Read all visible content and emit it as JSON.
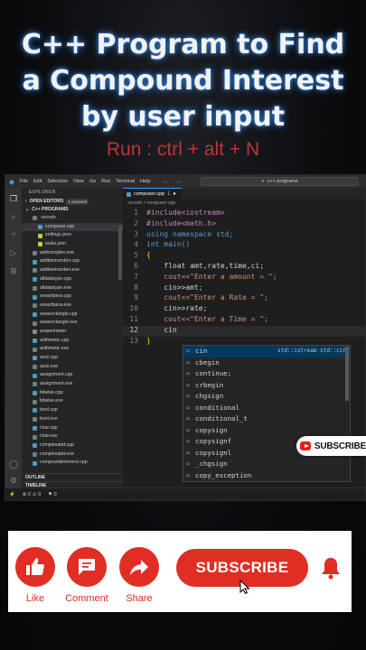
{
  "header": {
    "title_line1": "C++  Program to Find",
    "title_line2": "a Compound Interest",
    "title_line3": "by user input",
    "run_hint": "Run : ctrl + alt + N"
  },
  "vscode": {
    "menu": [
      "File",
      "Edit",
      "Selection",
      "View",
      "Go",
      "Run",
      "Terminal",
      "Help"
    ],
    "command_center": "c++ programs",
    "explorer_title": "EXPLORER",
    "open_editors": "OPEN EDITORS",
    "unsaved_badge": "1 unsaved",
    "folder": "C++ PROGRAMS",
    "files": [
      ".vscode",
      "compuser.cpp",
      "settings.json",
      "tasks.json",
      "addcomplex.exe",
      "addtwonumber.cpp",
      "addtwonumber.exe",
      "alldatatype.cpp",
      "alldatatype.exe",
      "areaofpera.cpp",
      "areaofpera.exe",
      "arearectangle.cpp",
      "arearectangle.exe",
      "areperimeter",
      "arithmetic.cpp",
      "arithmetic.exe",
      "ascii.cpp",
      "ascii.exe",
      "assignment.cpp",
      "assignment.exe",
      "bitwise.cpp",
      "bitwise.exe",
      "bool.cpp",
      "bool.exe",
      "char.cpp",
      "char.exe",
      "complexadd.cpp",
      "complexadd.exe",
      "compoundintererst.cpp"
    ],
    "outline": "OUTLINE",
    "timeline": "TIMELINE",
    "tab": {
      "name": "compuser.cpp",
      "index": "1"
    },
    "breadcrumb": ".vscode  >  compuser.cpp",
    "code_lines": [
      {
        "n": "1",
        "text": "#include<iostream>"
      },
      {
        "n": "2",
        "text": "#include<math.h>"
      },
      {
        "n": "3",
        "text": "using namespace std;"
      },
      {
        "n": "4",
        "text": "int main()"
      },
      {
        "n": "5",
        "text": "{"
      },
      {
        "n": "6",
        "text": "    float amt,rate,time,ci;"
      },
      {
        "n": "7",
        "text": "    cout<<\"Enter a amount = \";"
      },
      {
        "n": "8",
        "text": "    cin>>amt;"
      },
      {
        "n": "9",
        "text": "    cout<<\"Enter a Rate = \";"
      },
      {
        "n": "10",
        "text": "    cin>>rate;"
      },
      {
        "n": "11",
        "text": "    cout<<\"Enter a Time = \";"
      },
      {
        "n": "12",
        "text": "    cin"
      },
      {
        "n": "13",
        "text": "}"
      }
    ],
    "suggestions": [
      {
        "label": "cin",
        "detail": "std::istream std::cin"
      },
      {
        "label": "cbegin",
        "detail": ""
      },
      {
        "label": "continue;",
        "detail": ""
      },
      {
        "label": "crbegin",
        "detail": ""
      },
      {
        "label": "chgsign",
        "detail": ""
      },
      {
        "label": "conditional",
        "detail": ""
      },
      {
        "label": "conditional_t",
        "detail": ""
      },
      {
        "label": "copysign",
        "detail": ""
      },
      {
        "label": "copysignf",
        "detail": ""
      },
      {
        "label": "copysignl",
        "detail": ""
      },
      {
        "label": "_chgsign",
        "detail": ""
      },
      {
        "label": "copy_exception",
        "detail": ""
      }
    ],
    "status": {
      "errors": "0",
      "warnings": "0",
      "ports": "0"
    }
  },
  "overlay_subscribe": "SUBSCRIBE",
  "actions": {
    "like": "Like",
    "comment": "Comment",
    "share": "Share",
    "subscribe": "SUBSCRIBE"
  },
  "colors": {
    "accent_red": "#e02e24",
    "title_glow": "#2f7bd0",
    "run_red": "#c0333a"
  }
}
